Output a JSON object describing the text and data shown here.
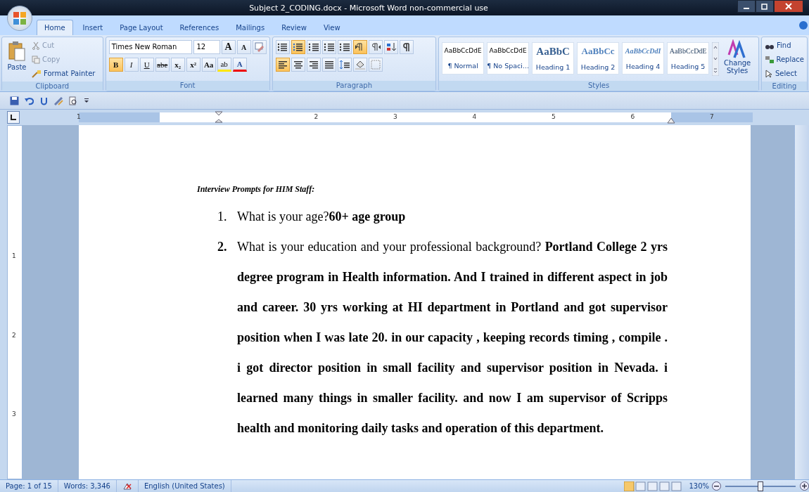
{
  "window": {
    "title": "Subject 2_CODING.docx - Microsoft Word non-commercial use"
  },
  "tabs": [
    {
      "label": "Home",
      "selected": true
    },
    {
      "label": "Insert",
      "selected": false
    },
    {
      "label": "Page Layout",
      "selected": false
    },
    {
      "label": "References",
      "selected": false
    },
    {
      "label": "Mailings",
      "selected": false
    },
    {
      "label": "Review",
      "selected": false
    },
    {
      "label": "View",
      "selected": false
    }
  ],
  "clipboard": {
    "paste": "Paste",
    "cut": "Cut",
    "copy": "Copy",
    "format_painter": "Format Painter",
    "label": "Clipboard"
  },
  "font": {
    "name": "Times New Roman",
    "size": "12",
    "label": "Font",
    "grow": "A",
    "shrink": "A",
    "buttons": [
      {
        "kind": "bold",
        "label": "B",
        "selected": true
      },
      {
        "kind": "italic",
        "label": "I",
        "selected": false
      },
      {
        "kind": "underline",
        "label": "U",
        "selected": false
      },
      {
        "kind": "strike",
        "label": "abe",
        "selected": false
      },
      {
        "kind": "sub",
        "label": "x₂",
        "selected": false
      },
      {
        "kind": "sup",
        "label": "x²",
        "selected": false
      },
      {
        "kind": "case",
        "label": "Aa",
        "selected": false
      },
      {
        "kind": "highlight",
        "label": "ab",
        "selected": false
      },
      {
        "kind": "color",
        "label": "A",
        "selected": false
      }
    ]
  },
  "paragraph": {
    "label": "Paragraph",
    "row1": [
      {
        "kind": "bullets",
        "selected": false
      },
      {
        "kind": "numbering",
        "selected": true
      },
      {
        "kind": "multilevel",
        "selected": false
      },
      {
        "kind": "outdent",
        "selected": false
      },
      {
        "kind": "indent",
        "selected": false
      },
      {
        "kind": "ltr",
        "selected": true
      },
      {
        "kind": "rtl",
        "selected": false
      },
      {
        "kind": "sort",
        "selected": false
      },
      {
        "kind": "marks",
        "selected": false
      }
    ],
    "row2": [
      {
        "kind": "left",
        "selected": true
      },
      {
        "kind": "center",
        "selected": false
      },
      {
        "kind": "right",
        "selected": false
      },
      {
        "kind": "justify",
        "selected": false
      },
      {
        "kind": "spacing",
        "selected": false
      },
      {
        "kind": "shading",
        "selected": false
      },
      {
        "kind": "borders",
        "selected": false
      }
    ]
  },
  "styles": {
    "label": "Styles",
    "items": [
      {
        "kind": "normal",
        "preview": "AaBbCcDdE",
        "name": "¶ Normal"
      },
      {
        "kind": "nospacing",
        "preview": "AaBbCcDdE",
        "name": "¶ No Spaci..."
      },
      {
        "kind": "heading1",
        "preview": "AaBbC",
        "name": "Heading 1"
      },
      {
        "kind": "heading2",
        "preview": "AaBbCc",
        "name": "Heading 2"
      },
      {
        "kind": "heading4",
        "preview": "AaBbCcDdI",
        "name": "Heading 4"
      },
      {
        "kind": "heading5",
        "preview": "AaBbCcDdE",
        "name": "Heading 5"
      }
    ],
    "change": "Change Styles"
  },
  "editing": {
    "label": "Editing",
    "find": "Find",
    "replace": "Replace",
    "select": "Select"
  },
  "ruler": {
    "numbers": [
      "1",
      "2",
      "3",
      "4",
      "5",
      "6",
      "7"
    ]
  },
  "vruler": {
    "numbers": [
      "1",
      "2",
      "3"
    ]
  },
  "document": {
    "heading": "Interview Prompts for HIM Staff:",
    "items": [
      {
        "number": "1.",
        "bold_number": false,
        "text": "What is your age?**60+ age group**"
      },
      {
        "number": "2.",
        "bold_number": true,
        "text": "What is your education and your professional background? **Portland College 2 yrs degree program in Health information.  And I trained in different aspect in job and career. 30 yrs working at HI department in Portland and got supervisor position when I was late 20. in our capacity , keeping records timing , compile . i got director position in small facility and supervisor position in Nevada. i learned many things in smaller facility. and now I am supervisor of Scripps health and monitoring daily tasks and operation of this department.**"
      }
    ]
  },
  "status_bar": {
    "page": "Page: 1 of 15",
    "words": "Words: 3,346",
    "language": "English (United States)",
    "zoom": "130%",
    "zoom_slider": {
      "level": 0.5
    }
  }
}
